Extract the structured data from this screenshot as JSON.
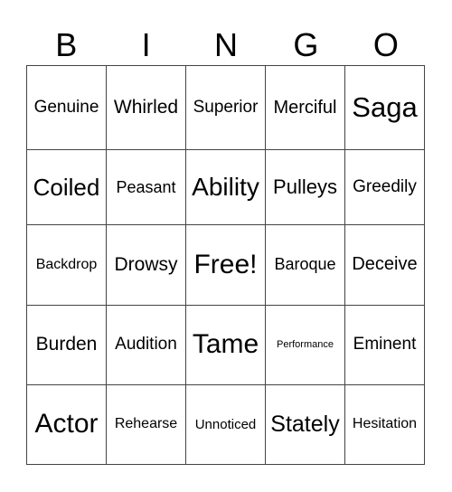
{
  "header": [
    "B",
    "I",
    "N",
    "G",
    "O"
  ],
  "cells": [
    [
      "Genuine",
      "Whirled",
      "Superior",
      "Merciful",
      "Saga"
    ],
    [
      "Coiled",
      "Peasant",
      "Ability",
      "Pulleys",
      "Greedily"
    ],
    [
      "Backdrop",
      "Drowsy",
      "Free!",
      "Baroque",
      "Deceive"
    ],
    [
      "Burden",
      "Audition",
      "Tame",
      "Performance",
      "Eminent"
    ],
    [
      "Actor",
      "Rehearse",
      "Unnoticed",
      "Stately",
      "Hesitation"
    ]
  ]
}
